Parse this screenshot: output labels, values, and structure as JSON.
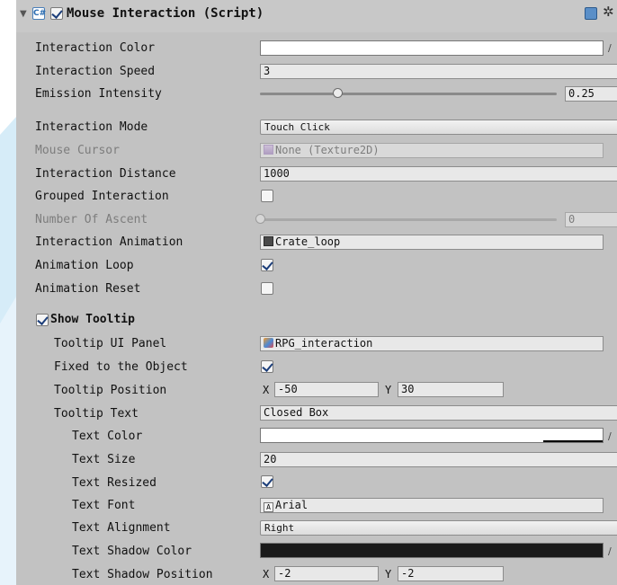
{
  "colors": {
    "inspector_bg": "#c2c2c2",
    "text_shadow_color": "#1a1a1a",
    "text_color_bar": "#000000"
  },
  "header": {
    "foldout_icon": "triangle-down",
    "script_icon": "script-icon",
    "enabled": true,
    "title": "Mouse Interaction (Script)",
    "help_icon": "help-icon",
    "gear_icon": "gear-icon"
  },
  "props": {
    "interaction_color": {
      "label": "Interaction Color"
    },
    "interaction_speed": {
      "label": "Interaction Speed",
      "value": "3"
    },
    "emission_intensity": {
      "label": "Emission Intensity",
      "value": "0.25",
      "fraction": 0.26
    },
    "interaction_mode": {
      "label": "Interaction Mode",
      "value": "Touch Click"
    },
    "mouse_cursor": {
      "label": "Mouse Cursor",
      "value": "None (Texture2D)"
    },
    "interaction_distance": {
      "label": "Interaction Distance",
      "value": "1000"
    },
    "grouped_interaction": {
      "label": "Grouped Interaction",
      "checked": false
    },
    "number_of_ascent": {
      "label": "Number Of Ascent",
      "value": "0",
      "fraction": 0
    },
    "interaction_animation": {
      "label": "Interaction Animation",
      "value": "Crate_loop"
    },
    "animation_loop": {
      "label": "Animation Loop",
      "checked": true
    },
    "animation_reset": {
      "label": "Animation Reset",
      "checked": false
    },
    "show_tooltip": {
      "label": "Show Tooltip",
      "checked": true
    },
    "tooltip_ui_panel": {
      "label": "Tooltip UI Panel",
      "value": "RPG_interaction"
    },
    "fixed_to_object": {
      "label": "Fixed to the Object",
      "checked": true
    },
    "tooltip_position": {
      "label": "Tooltip Position",
      "x_label": "X",
      "x": "-50",
      "y_label": "Y",
      "y": "30"
    },
    "tooltip_text": {
      "label": "Tooltip Text",
      "value": "Closed Box"
    },
    "text_color": {
      "label": "Text Color"
    },
    "text_size": {
      "label": "Text Size",
      "value": "20"
    },
    "text_resized": {
      "label": "Text Resized",
      "checked": true
    },
    "text_font": {
      "label": "Text Font",
      "value": "Arial"
    },
    "text_alignment": {
      "label": "Text Alignment",
      "value": "Right"
    },
    "text_shadow_color": {
      "label": "Text Shadow Color"
    },
    "text_shadow_position": {
      "label": "Text Shadow Position",
      "x_label": "X",
      "x": "-2",
      "y_label": "Y",
      "y": "-2"
    }
  }
}
